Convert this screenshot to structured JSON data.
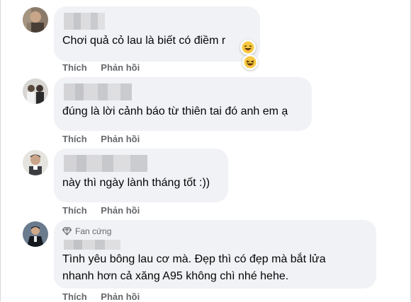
{
  "comments": [
    {
      "text": "Chơi quả cỏ lau là biết có điềm r",
      "like_label": "Thích",
      "reply_label": "Phản hồi",
      "reaction_icon": "haha-emoji-icon"
    },
    {
      "text": "đúng là lời cảnh báo từ thiên tai đó anh em ạ",
      "like_label": "Thích",
      "reply_label": "Phản hồi"
    },
    {
      "text": "này thì ngày lành tháng tốt :))",
      "like_label": "Thích",
      "reply_label": "Phản hồi"
    },
    {
      "badge": "Fan cứng",
      "text": "Tình yêu bông lau cơ mà. Đẹp thì có đẹp mà bắt lửa\nnhanh hơn cả xăng A95 không chì nhé hehe.",
      "like_label": "Thích",
      "reply_label": "Phản hồi"
    }
  ]
}
